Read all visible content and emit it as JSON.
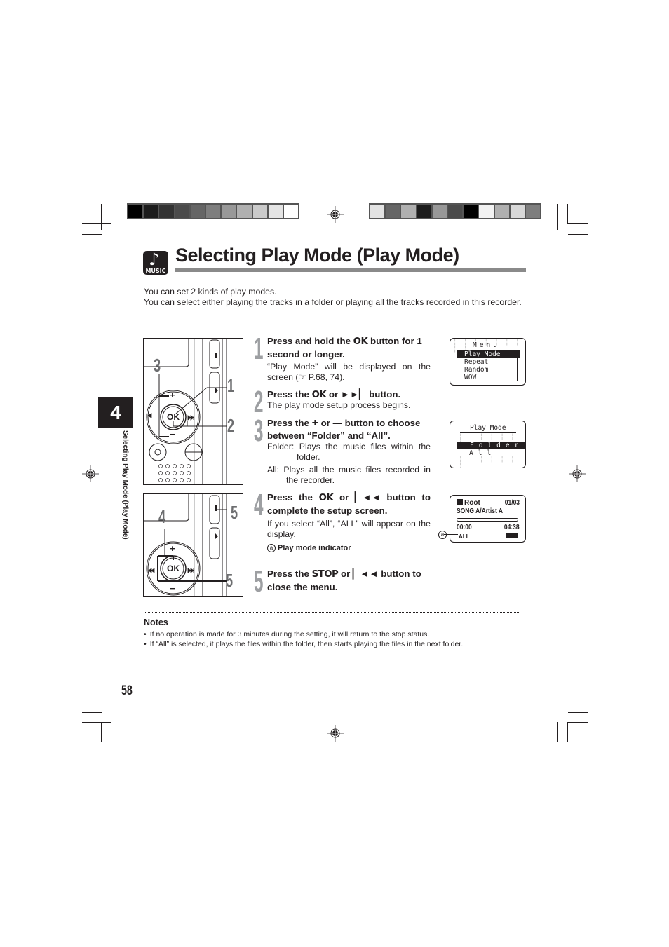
{
  "color_bars": {
    "left": [
      "#000000",
      "#1c1c1c",
      "#333333",
      "#4b4b4b",
      "#656565",
      "#7e7e7e",
      "#989898",
      "#b0b0b0",
      "#cacaca",
      "#e4e4e4",
      "#ffffff"
    ],
    "right": [
      "#e3e3e3",
      "#666666",
      "#b0b0b0",
      "#1c1c1c",
      "#989898",
      "#4b4b4b",
      "#000000",
      "#f2f2f2",
      "#b0b0b0",
      "#d8d8d8",
      "#7e7e7e"
    ]
  },
  "header": {
    "icon_label": "MUSIC",
    "icon_glyph": "♪",
    "title": "Selecting Play Mode (Play Mode)"
  },
  "intro": [
    "You can set 2 kinds of play modes.",
    "You can select either playing the tracks in a folder or playing all the tracks recorded in this recorder."
  ],
  "chapter": {
    "number": "4",
    "side_label": "Selecting Play Mode (Play Mode)"
  },
  "figures": {
    "top_callouts": [
      "3",
      "1",
      "2"
    ],
    "bottom_callouts": [
      "4",
      "5",
      "5"
    ],
    "ok_label": "OK",
    "plus": "+",
    "minus": "−"
  },
  "steps": [
    {
      "number": "1",
      "head_parts": [
        "Press and hold the ",
        "OK",
        " button for 1 second or longer."
      ],
      "body": [
        "“Play Mode” will be displayed on the screen (☞ P.68, 74)."
      ]
    },
    {
      "number": "2",
      "head_parts": [
        "Press the ",
        "OK",
        " or ►►▏ button."
      ],
      "body": [
        "The play mode setup process begins."
      ]
    },
    {
      "number": "3",
      "head_parts": [
        "Press the ",
        "+",
        " or ",
        "—",
        " button to choose between “Folder” and “All”."
      ],
      "body": [
        "Folder: Plays the music files within the folder.",
        "All:  Plays all the music files recorded in the recorder."
      ]
    },
    {
      "number": "4",
      "head_parts": [
        "Press the ",
        "OK",
        " or ▏◄◄ button to complete the setup screen."
      ],
      "body": [
        "If you select “All”, “ALL” will appear on the display."
      ],
      "callout_marker": "a",
      "callout_text": "Play mode indicator"
    },
    {
      "number": "5",
      "head_parts": [
        "Press the ",
        "STOP",
        " or ▏◄◄ button to close the menu."
      ],
      "body": []
    }
  ],
  "screens": {
    "menu": {
      "title": "Menu",
      "items": [
        "Play Mode",
        "Repeat",
        "Random",
        "WOW"
      ],
      "selected_index": 0
    },
    "play_mode": {
      "title": "Play Mode",
      "options": [
        "Folder",
        "All"
      ],
      "selected_index": 0
    },
    "playback": {
      "folder": "Root",
      "track_counter": "01/03",
      "song": "SONG A/Artist A",
      "elapsed": "00:00",
      "total": "04:38",
      "mode_indicator": "ALL",
      "marker": "a"
    }
  },
  "notes": {
    "title": "Notes",
    "items": [
      "If no operation is made for 3 minutes during the setting, it will return to the stop status.",
      "If “All” is selected, it plays the files within the folder, then starts playing the files in the next folder."
    ]
  },
  "page_number": "58"
}
